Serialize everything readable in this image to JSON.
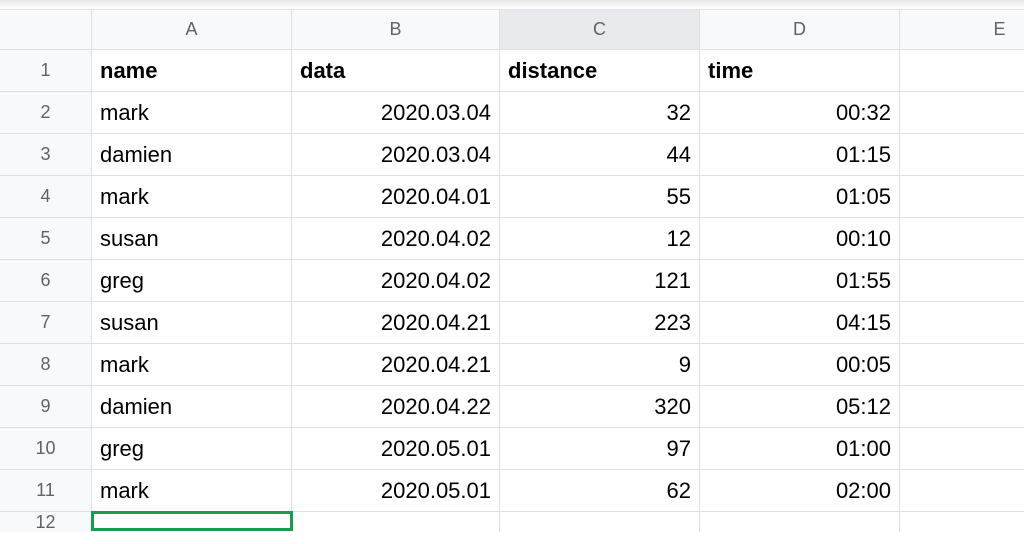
{
  "columns": [
    "A",
    "B",
    "C",
    "D",
    "E"
  ],
  "selected_column_index": 2,
  "headers": {
    "A": "name",
    "B": "data",
    "C": "distance",
    "D": "time",
    "E": ""
  },
  "rows": [
    {
      "n": "1"
    },
    {
      "n": "2",
      "A": "mark",
      "B": "2020.03.04",
      "C": "32",
      "D": "00:32"
    },
    {
      "n": "3",
      "A": "damien",
      "B": "2020.03.04",
      "C": "44",
      "D": "01:15"
    },
    {
      "n": "4",
      "A": "mark",
      "B": "2020.04.01",
      "C": "55",
      "D": "01:05"
    },
    {
      "n": "5",
      "A": "susan",
      "B": "2020.04.02",
      "C": "12",
      "D": "00:10"
    },
    {
      "n": "6",
      "A": "greg",
      "B": "2020.04.02",
      "C": "121",
      "D": "01:55"
    },
    {
      "n": "7",
      "A": "susan",
      "B": "2020.04.21",
      "C": "223",
      "D": "04:15"
    },
    {
      "n": "8",
      "A": "mark",
      "B": "2020.04.21",
      "C": "9",
      "D": "00:05"
    },
    {
      "n": "9",
      "A": "damien",
      "B": "2020.04.22",
      "C": "320",
      "D": "05:12"
    },
    {
      "n": "10",
      "A": "greg",
      "B": "2020.05.01",
      "C": "97",
      "D": "01:00"
    },
    {
      "n": "11",
      "A": "mark",
      "B": "2020.05.01",
      "C": "62",
      "D": "02:00"
    }
  ],
  "partial_row": {
    "n": "12"
  },
  "active_cell": "A12",
  "chart_data": {
    "type": "table",
    "columns": [
      "name",
      "data",
      "distance",
      "time"
    ],
    "rows": [
      [
        "mark",
        "2020.03.04",
        32,
        "00:32"
      ],
      [
        "damien",
        "2020.03.04",
        44,
        "01:15"
      ],
      [
        "mark",
        "2020.04.01",
        55,
        "01:05"
      ],
      [
        "susan",
        "2020.04.02",
        12,
        "00:10"
      ],
      [
        "greg",
        "2020.04.02",
        121,
        "01:55"
      ],
      [
        "susan",
        "2020.04.21",
        223,
        "04:15"
      ],
      [
        "mark",
        "2020.04.21",
        9,
        "00:05"
      ],
      [
        "damien",
        "2020.04.22",
        320,
        "05:12"
      ],
      [
        "greg",
        "2020.05.01",
        97,
        "01:00"
      ],
      [
        "mark",
        "2020.05.01",
        62,
        "02:00"
      ]
    ]
  }
}
